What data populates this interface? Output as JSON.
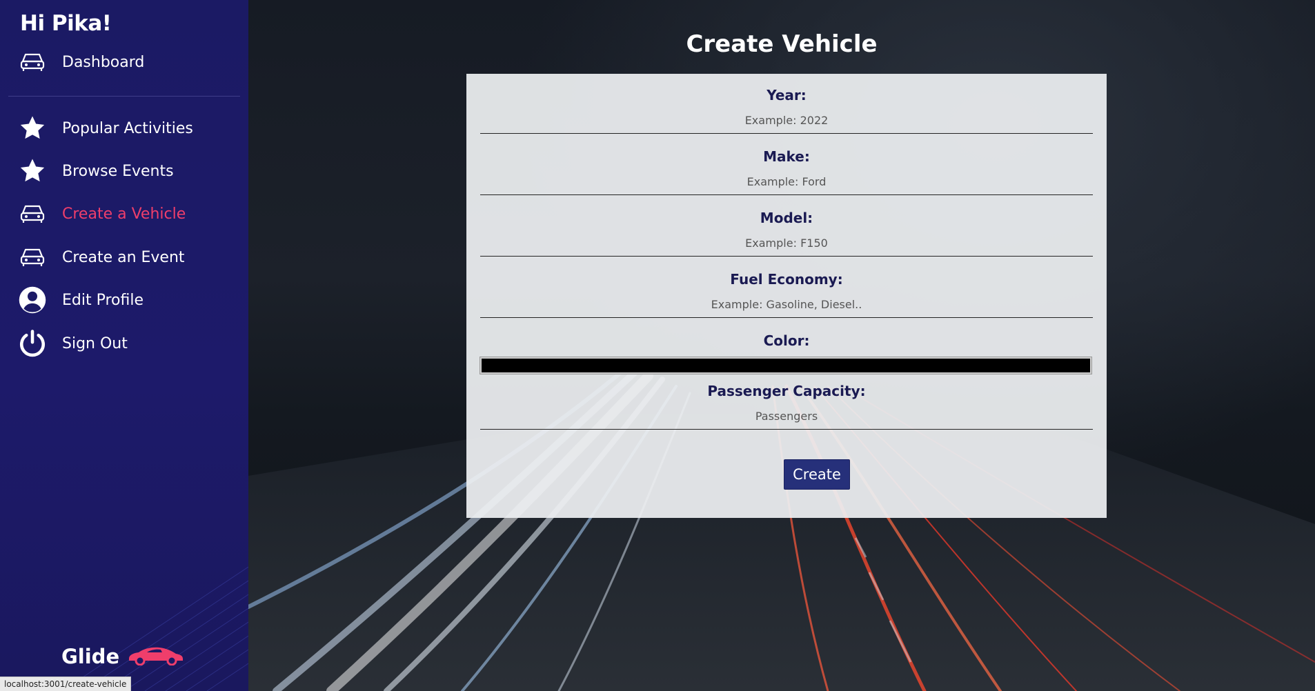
{
  "sidebar": {
    "greeting": "Hi Pika!",
    "items": [
      {
        "label": "Dashboard",
        "icon": "car-icon",
        "active": false
      },
      {
        "label": "Popular Activities",
        "icon": "star-icon",
        "active": false
      },
      {
        "label": "Browse Events",
        "icon": "star-icon",
        "active": false
      },
      {
        "label": "Create a Vehicle",
        "icon": "car-icon",
        "active": true
      },
      {
        "label": "Create an Event",
        "icon": "car-icon",
        "active": false
      },
      {
        "label": "Edit Profile",
        "icon": "user-circle-icon",
        "active": false
      },
      {
        "label": "Sign Out",
        "icon": "power-icon",
        "active": false
      }
    ],
    "brand": "Glide"
  },
  "status_url": "localhost:3001/create-vehicle",
  "main": {
    "title": "Create Vehicle",
    "form": {
      "year": {
        "label": "Year:",
        "placeholder": "Example: 2022"
      },
      "make": {
        "label": "Make:",
        "placeholder": "Example: Ford"
      },
      "model": {
        "label": "Model:",
        "placeholder": "Example: F150"
      },
      "fuel": {
        "label": "Fuel Economy:",
        "placeholder": "Example: Gasoline, Diesel.."
      },
      "color": {
        "label": "Color:",
        "value": "#000000"
      },
      "capacity": {
        "label": "Passenger Capacity:",
        "placeholder": "Passengers"
      },
      "submit": "Create"
    }
  },
  "colors": {
    "sidebar_bg": "#1c1a66",
    "active_nav": "#ef3e6b",
    "button_bg": "#26307a",
    "label_text": "#1a1a52"
  }
}
